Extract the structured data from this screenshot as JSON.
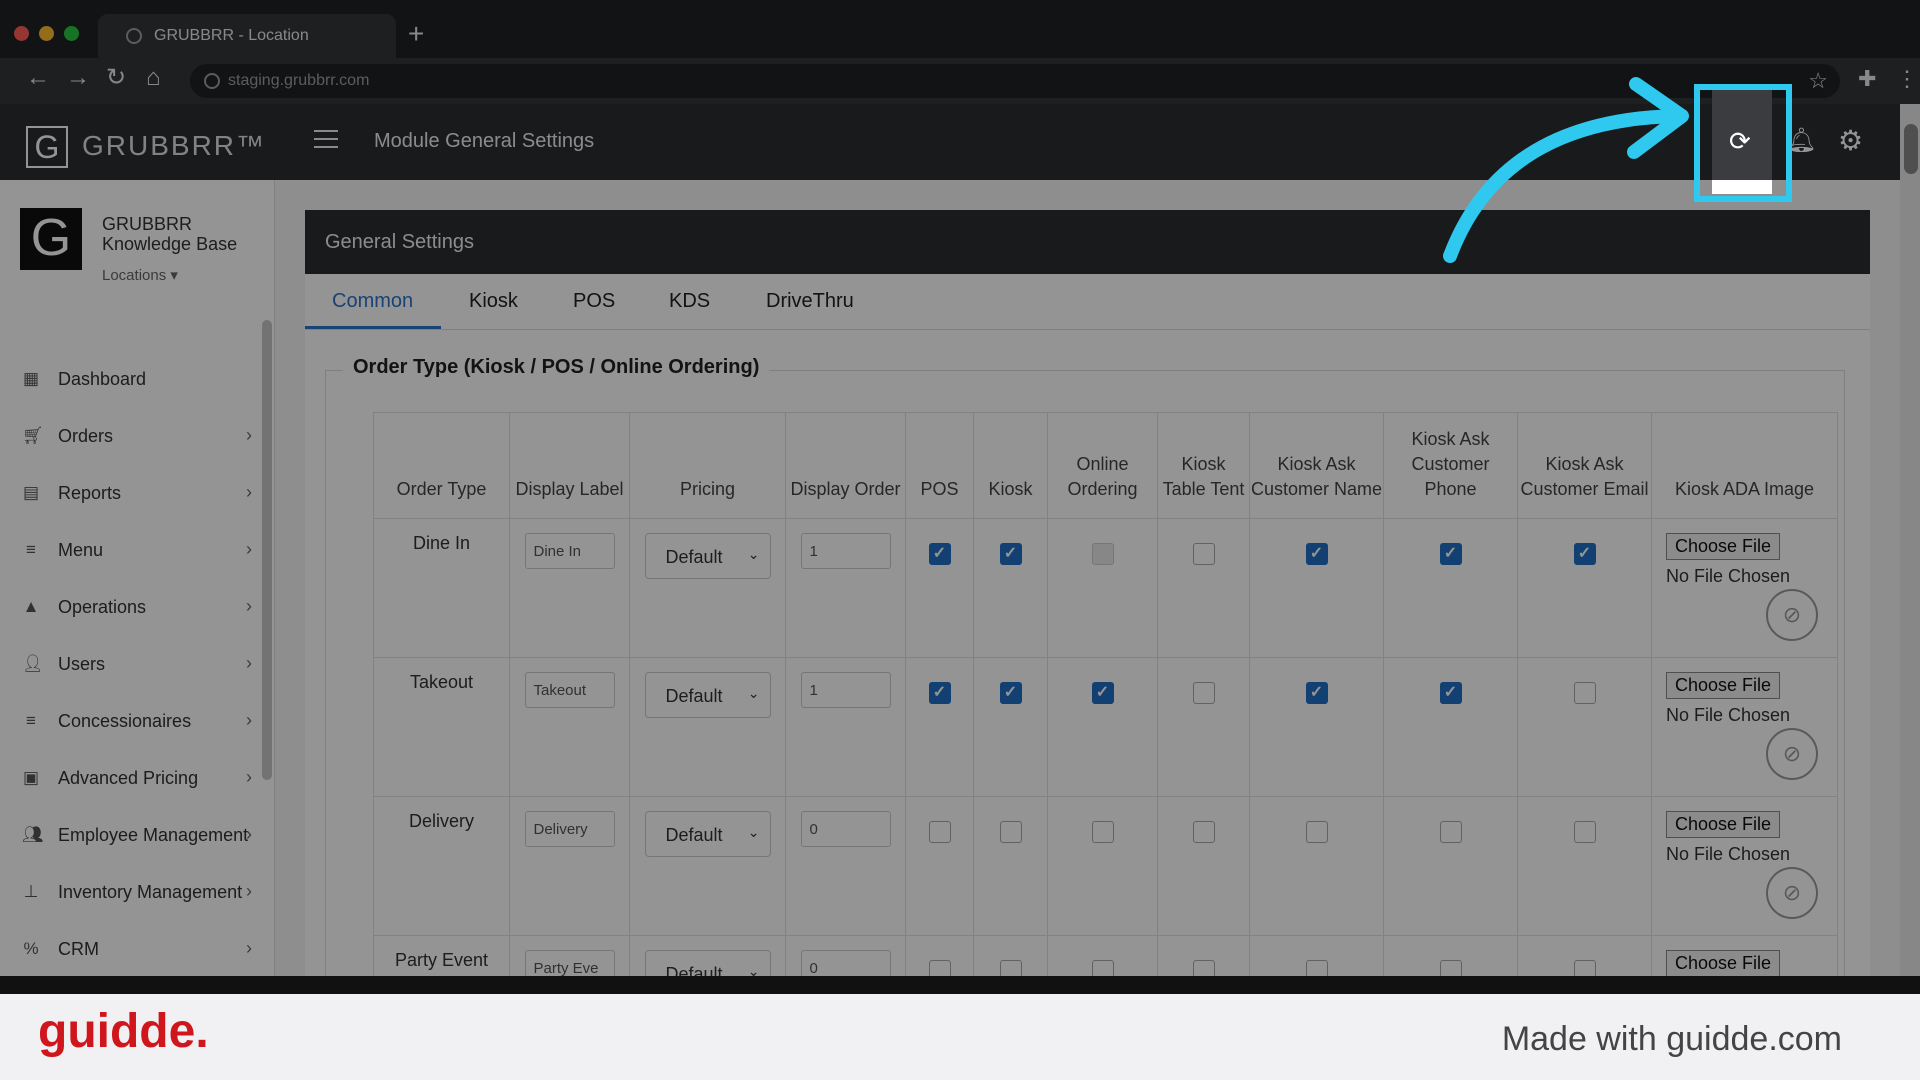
{
  "browser": {
    "tab_title": "GRUBBRR - Location",
    "new_tab": "+",
    "url": "staging.grubbrr.com"
  },
  "app": {
    "logo_letter": "G",
    "logo_text": "GRUBBRR™",
    "module_title": "Module General Settings"
  },
  "sidebar": {
    "org_name": "GRUBBRR Knowledge Base",
    "locations_label": "Locations ▾",
    "items": [
      {
        "label": "Dashboard",
        "icon": "dashboard-icon",
        "has_chevron": false
      },
      {
        "label": "Orders",
        "icon": "cart-icon",
        "has_chevron": true
      },
      {
        "label": "Reports",
        "icon": "report-icon",
        "has_chevron": true
      },
      {
        "label": "Menu",
        "icon": "menu-list-icon",
        "has_chevron": true
      },
      {
        "label": "Operations",
        "icon": "flask-icon",
        "has_chevron": true
      },
      {
        "label": "Users",
        "icon": "user-add-icon",
        "has_chevron": true
      },
      {
        "label": "Concessionaires",
        "icon": "list-icon",
        "has_chevron": true
      },
      {
        "label": "Advanced Pricing",
        "icon": "money-icon",
        "has_chevron": true
      },
      {
        "label": "Employee Management",
        "icon": "users-icon",
        "has_chevron": true
      },
      {
        "label": "Inventory Management",
        "icon": "sitemap-icon",
        "has_chevron": true
      },
      {
        "label": "CRM",
        "icon": "percent-icon",
        "has_chevron": true
      }
    ]
  },
  "card": {
    "title": "General Settings",
    "tabs": [
      "Common",
      "Kiosk",
      "POS",
      "KDS",
      "DriveThru"
    ],
    "active_tab": "Common",
    "section_title": "Order Type (Kiosk / POS / Online Ordering)"
  },
  "table": {
    "headers": [
      "Order Type",
      "Display Label",
      "Pricing",
      "Display Order",
      "POS",
      "Kiosk",
      "Online Ordering",
      "Kiosk Table Tent",
      "Kiosk Ask Customer Name",
      "Kiosk Ask Customer Phone",
      "Kiosk Ask Customer Email",
      "Kiosk ADA Image"
    ],
    "choose_file_label": "Choose File",
    "no_file_label": "No File Chosen",
    "rows": [
      {
        "order_type": "Dine In",
        "display_label": "Dine In",
        "pricing": "Default",
        "display_order": "1",
        "checks": [
          "on",
          "on",
          "dis",
          "off",
          "on",
          "on",
          "on"
        ],
        "show_no_file": true
      },
      {
        "order_type": "Takeout",
        "display_label": "Takeout",
        "pricing": "Default",
        "display_order": "1",
        "checks": [
          "on",
          "on",
          "on",
          "off",
          "on",
          "on",
          "off"
        ],
        "show_no_file": true
      },
      {
        "order_type": "Delivery",
        "display_label": "Delivery",
        "pricing": "Default",
        "display_order": "0",
        "checks": [
          "off",
          "off",
          "off",
          "off",
          "off",
          "off",
          "off"
        ],
        "show_no_file": true
      },
      {
        "order_type": "Party Event",
        "display_label": "Party Eve",
        "pricing": "Default",
        "display_order": "0",
        "checks": [
          "off",
          "off",
          "off",
          "off",
          "off",
          "off",
          "off"
        ],
        "show_no_file": false
      }
    ]
  },
  "watermark": {
    "brand": "guidde.",
    "made_with": "Made with guidde.com"
  },
  "colors": {
    "accent": "#2a74c9",
    "highlight": "#2fc9ef",
    "brand_red": "#d0161d"
  }
}
